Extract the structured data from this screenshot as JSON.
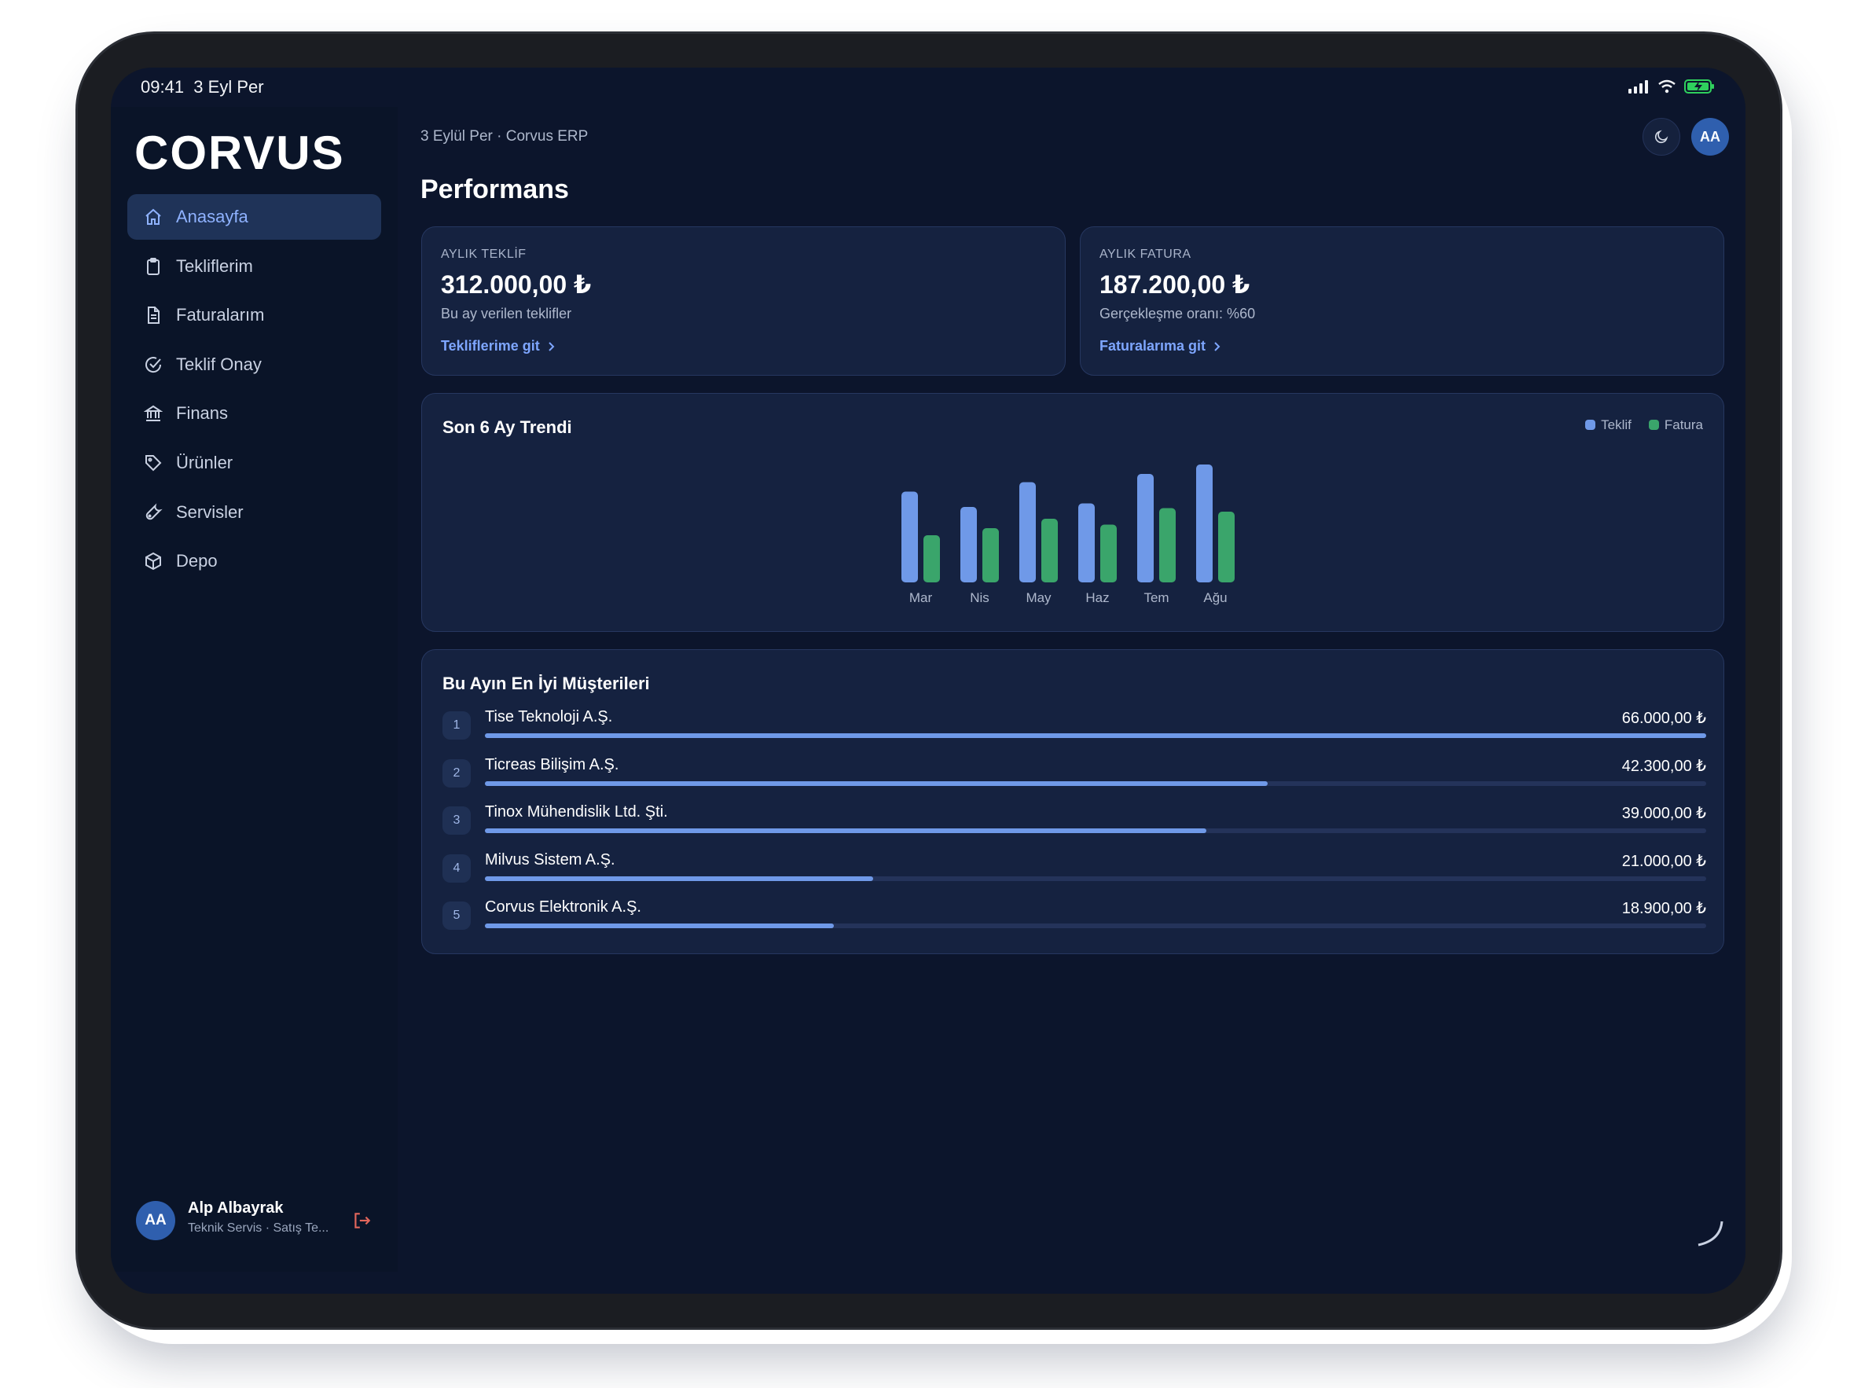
{
  "status_bar": {
    "time": "09:41",
    "date": "3 Eyl Per"
  },
  "sidebar": {
    "logo": "CORVUS",
    "items": [
      {
        "label": "Anasayfa",
        "icon": "home-icon",
        "active": true
      },
      {
        "label": "Tekliflerim",
        "icon": "clipboard-icon",
        "active": false
      },
      {
        "label": "Faturalarım",
        "icon": "document-icon",
        "active": false
      },
      {
        "label": "Teklif Onay",
        "icon": "check-circle-icon",
        "active": false
      },
      {
        "label": "Finans",
        "icon": "bank-icon",
        "active": false
      },
      {
        "label": "Ürünler",
        "icon": "tag-icon",
        "active": false
      },
      {
        "label": "Servisler",
        "icon": "wrench-icon",
        "active": false
      },
      {
        "label": "Depo",
        "icon": "box-icon",
        "active": false
      }
    ],
    "user": {
      "initials": "AA",
      "name": "Alp Albayrak",
      "role": "Teknik Servis · Satış Te..."
    }
  },
  "header": {
    "breadcrumb": "3 Eylül Per · Corvus ERP",
    "title": "Performans",
    "avatar_initials": "AA"
  },
  "kpis": [
    {
      "label": "AYLIK TEKLİF",
      "value": "312.000,00 ₺",
      "subtitle": "Bu ay verilen teklifler",
      "link": "Tekliflerime git"
    },
    {
      "label": "AYLIK FATURA",
      "value": "187.200,00 ₺",
      "subtitle": "Gerçekleşme oranı: %60",
      "link": "Faturalarıma git"
    }
  ],
  "trend": {
    "title": "Son 6 Ay Trendi"
  },
  "chart_data": {
    "type": "bar",
    "title": "Son 6 Ay Trendi",
    "categories": [
      "Mar",
      "Nis",
      "May",
      "Haz",
      "Tem",
      "Ağu"
    ],
    "series": [
      {
        "name": "Teklif",
        "color": "#6f99e8",
        "values": [
          77,
          64,
          85,
          67,
          92,
          100
        ]
      },
      {
        "name": "Fatura",
        "color": "#3aa56b",
        "values": [
          40,
          46,
          54,
          49,
          63,
          60
        ]
      }
    ],
    "ylim": [
      0,
      100
    ],
    "grid": false,
    "legend": "top-right"
  },
  "top_customers": {
    "title": "Bu Ayın En İyi Müşterileri",
    "rows": [
      {
        "rank": "1",
        "name": "Tise Teknoloji A.Ş.",
        "amount": "66.000,00 ₺",
        "share": 1.0
      },
      {
        "rank": "2",
        "name": "Ticreas Bilişim A.Ş.",
        "amount": "42.300,00 ₺",
        "share": 0.641
      },
      {
        "rank": "3",
        "name": "Tinox Mühendislik Ltd. Şti.",
        "amount": "39.000,00 ₺",
        "share": 0.591
      },
      {
        "rank": "4",
        "name": "Milvus Sistem A.Ş.",
        "amount": "21.000,00 ₺",
        "share": 0.318
      },
      {
        "rank": "5",
        "name": "Corvus Elektronik A.Ş.",
        "amount": "18.900,00 ₺",
        "share": 0.286
      }
    ]
  },
  "colors": {
    "background": "#0c152c",
    "card": "#152240",
    "accent": "#7ea6ff",
    "teklif": "#6f99e8",
    "fatura": "#3aa56b"
  }
}
